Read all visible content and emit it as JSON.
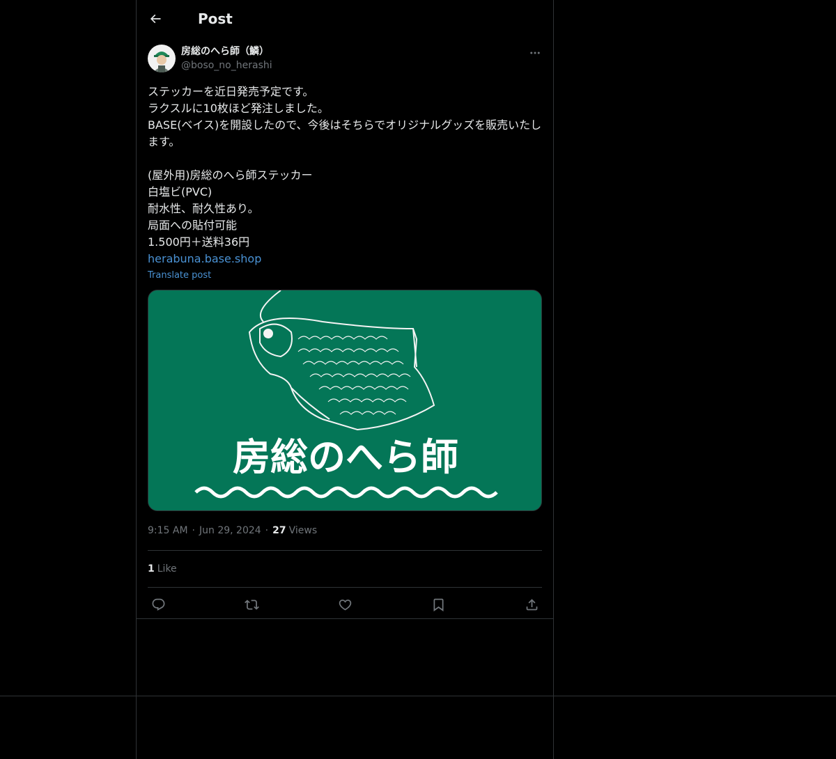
{
  "header": {
    "title": "Post"
  },
  "post": {
    "author": {
      "display_name": "房総のへら師（鱗）",
      "handle": "@boso_no_herashi"
    },
    "text_lines": [
      "ステッカーを近日発売予定です。",
      "ラクスルに10枚ほど発注しました。",
      "BASE(ベイス)を開設したので、今後はそちらでオリジナルグッズを販売いたします。",
      "",
      "(屋外用)房総のへら師ステッカー",
      "白塩ビ(PVC)",
      "耐水性、耐久性あり。",
      "局面への貼付可能",
      "1.500円＋送料36円"
    ],
    "link": "herabuna.base.shop",
    "translate_label": "Translate post",
    "image": {
      "caption": "房総のへら師",
      "background": "#047657"
    },
    "time": "9:15 AM",
    "date": "Jun 29, 2024",
    "views_count": "27",
    "views_label": "Views",
    "likes_count": "1",
    "likes_label": "Like"
  },
  "icons": {
    "back": "arrow-left-icon",
    "more": "more-horizontal-icon",
    "reply": "reply-icon",
    "repost": "repost-icon",
    "like": "heart-icon",
    "bookmark": "bookmark-icon",
    "share": "share-icon"
  },
  "colors": {
    "accent_link": "#4a92d4",
    "muted": "#71767b",
    "border": "#2f3336",
    "sticker_green": "#047657"
  }
}
